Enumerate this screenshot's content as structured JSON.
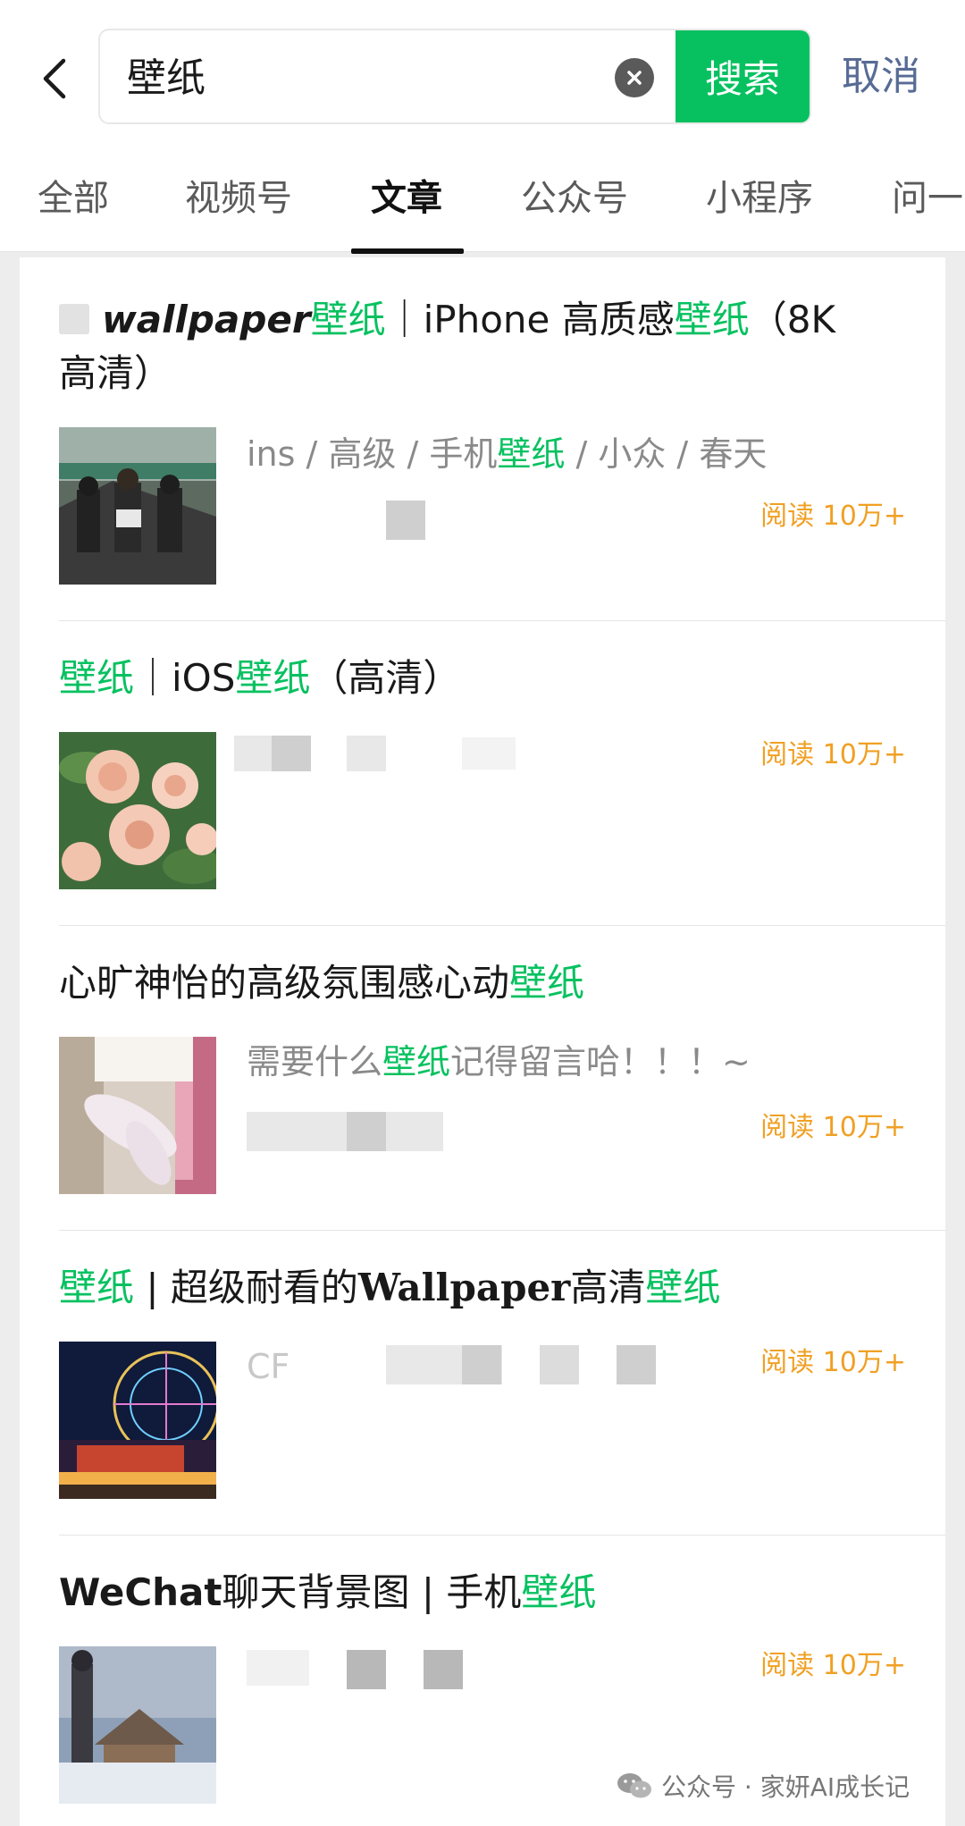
{
  "header": {
    "query": "壁纸",
    "search_label": "搜索",
    "cancel_label": "取消"
  },
  "tabs": [
    {
      "label": "全部"
    },
    {
      "label": "视频号"
    },
    {
      "label": "文章",
      "active": true
    },
    {
      "label": "公众号"
    },
    {
      "label": "小程序"
    },
    {
      "label": "问一"
    }
  ],
  "results": [
    {
      "title_parts": [
        "wallpaper",
        "壁纸",
        "｜iPhone 高质感",
        "壁纸",
        "（8K",
        "高清）"
      ],
      "desc_parts": [
        "ins / 高级 / 手机",
        "壁纸",
        " / 小众 / 春天"
      ],
      "read_count": "阅读 10万+"
    },
    {
      "title_parts": [
        "壁纸",
        "｜iOS",
        "壁纸",
        "（高清）"
      ],
      "read_count": "阅读 10万+"
    },
    {
      "title_parts": [
        "心旷神怡的高级氛围感心动",
        "壁纸"
      ],
      "desc_parts": [
        "需要什么",
        "壁纸",
        "记得留言哈！！！~"
      ],
      "read_count": "阅读 10万+"
    },
    {
      "title_parts": [
        "壁纸",
        " | 超级耐看的",
        "Wallpaper",
        "高清",
        "壁纸"
      ],
      "desc_prefix": "CF",
      "read_count": "阅读 10万+"
    },
    {
      "title_parts": [
        "WeChat",
        "聊天背景图 | 手机",
        "壁纸"
      ],
      "read_count": "阅读 10万+"
    }
  ],
  "watermark": "公众号 · 家妍AI成长记",
  "colors": {
    "accent": "#07c160",
    "link": "#576b95",
    "read_count": "#f0a024"
  }
}
